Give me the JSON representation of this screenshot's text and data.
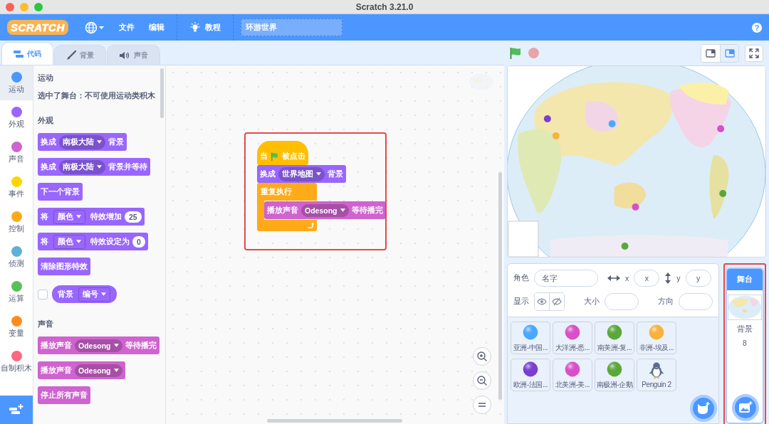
{
  "window": {
    "title": "Scratch 3.21.0"
  },
  "menu": {
    "logo": "SCRATCH",
    "items": [
      {
        "kind": "language"
      },
      {
        "kind": "text",
        "label": "文件"
      },
      {
        "kind": "text",
        "label": "编辑"
      },
      {
        "kind": "tutorial",
        "label": "教程"
      }
    ],
    "project_title": "环游世界",
    "help": "?"
  },
  "tabs": [
    {
      "kind": "code",
      "label": "代码",
      "selected": true
    },
    {
      "kind": "brush",
      "label": "背景",
      "selected": false
    },
    {
      "kind": "sound",
      "label": "声音",
      "selected": false
    }
  ],
  "categories": [
    {
      "label": "运动",
      "color": "#4c97ff",
      "selected": true
    },
    {
      "label": "外观",
      "color": "#9966ff",
      "selected": false
    },
    {
      "label": "声音",
      "color": "#cf63cf",
      "selected": false
    },
    {
      "label": "事件",
      "color": "#ffd500",
      "selected": false
    },
    {
      "label": "控制",
      "color": "#ffab19",
      "selected": false
    },
    {
      "label": "侦测",
      "color": "#5cb1d6",
      "selected": false
    },
    {
      "label": "运算",
      "color": "#59c059",
      "selected": false
    },
    {
      "label": "变量",
      "color": "#ff8c1a",
      "selected": false
    },
    {
      "label": "自制积木",
      "color": "#ff6680",
      "selected": false
    }
  ],
  "palette": [
    {
      "kind": "heading",
      "text": "运动"
    },
    {
      "kind": "note",
      "text": "选中了舞台：不可使用运动类积木"
    },
    {
      "kind": "heading",
      "text": "外观"
    },
    {
      "kind": "block",
      "color": "#9966ff",
      "parts": [
        {
          "kind": "text",
          "text": "换成"
        },
        {
          "kind": "dropdown",
          "text": "南极大陆"
        },
        {
          "kind": "text",
          "text": "背景"
        }
      ]
    },
    {
      "kind": "block",
      "color": "#9966ff",
      "parts": [
        {
          "kind": "text",
          "text": "换成"
        },
        {
          "kind": "dropdown",
          "text": "南极大陆"
        },
        {
          "kind": "text",
          "text": "背景并等待"
        }
      ]
    },
    {
      "kind": "block",
      "color": "#9966ff",
      "parts": [
        {
          "kind": "text",
          "text": "下一个背景"
        }
      ]
    },
    {
      "kind": "block",
      "color": "#9966ff",
      "parts": [
        {
          "kind": "text",
          "text": "将"
        },
        {
          "kind": "menu",
          "text": "颜色"
        },
        {
          "kind": "text",
          "text": "特效增加"
        },
        {
          "kind": "number",
          "text": "25"
        }
      ]
    },
    {
      "kind": "block",
      "color": "#9966ff",
      "parts": [
        {
          "kind": "text",
          "text": "将"
        },
        {
          "kind": "menu",
          "text": "颜色"
        },
        {
          "kind": "text",
          "text": "特效设定为"
        },
        {
          "kind": "number",
          "text": "0"
        }
      ]
    },
    {
      "kind": "block",
      "color": "#9966ff",
      "parts": [
        {
          "kind": "text",
          "text": "清除图形特效"
        }
      ]
    },
    {
      "kind": "reporter",
      "color": "#9966ff",
      "checked": false,
      "parts": [
        {
          "kind": "text",
          "text": "背景"
        },
        {
          "kind": "menu",
          "text": "编号"
        }
      ]
    },
    {
      "kind": "heading",
      "text": "声音"
    },
    {
      "kind": "block",
      "color": "#cf63cf",
      "parts": [
        {
          "kind": "text",
          "text": "播放声音"
        },
        {
          "kind": "dropdown",
          "text": "Odesong"
        },
        {
          "kind": "text",
          "text": "等待播完"
        }
      ]
    },
    {
      "kind": "block",
      "color": "#cf63cf",
      "parts": [
        {
          "kind": "text",
          "text": "播放声音"
        },
        {
          "kind": "dropdown",
          "text": "Odesong"
        }
      ]
    },
    {
      "kind": "block",
      "color": "#cf63cf",
      "parts": [
        {
          "kind": "text",
          "text": "停止所有声音"
        }
      ]
    }
  ],
  "script": [
    {
      "kind": "hat",
      "color": "#ffbf00",
      "parts": [
        {
          "kind": "text",
          "text": "当"
        },
        {
          "kind": "flag"
        },
        {
          "kind": "text",
          "text": "被点击"
        }
      ]
    },
    {
      "kind": "stack",
      "color": "#9966ff",
      "parts": [
        {
          "kind": "text",
          "text": "换成"
        },
        {
          "kind": "dropdown",
          "text": "世界地图"
        },
        {
          "kind": "text",
          "text": "背景"
        }
      ]
    },
    {
      "kind": "c",
      "color": "#ffab19",
      "parts": [
        {
          "kind": "text",
          "text": "重复执行"
        }
      ],
      "children": [
        {
          "kind": "stack",
          "color": "#cf63cf",
          "parts": [
            {
              "kind": "text",
              "text": "播放声音"
            },
            {
              "kind": "dropdown",
              "text": "Odesong"
            },
            {
              "kind": "text",
              "text": "等待播完"
            }
          ]
        }
      ]
    }
  ],
  "sprite_info": {
    "sprite_label": "角色",
    "name_placeholder": "名字",
    "x_label": "x",
    "x_placeholder": "x",
    "y_label": "y",
    "y_placeholder": "y",
    "show_label": "显示",
    "size_label": "大小",
    "direction_label": "方向"
  },
  "sprites": [
    {
      "kind": "ball",
      "name": "亚洲-中国...",
      "color": "#4aa8ff"
    },
    {
      "kind": "ball",
      "name": "大洋洲-悉...",
      "color": "#d94fc8"
    },
    {
      "kind": "ball",
      "name": "南美洲-复...",
      "color": "#5aa83a"
    },
    {
      "kind": "ball",
      "name": "非洲-埃及...",
      "color": "#f7b23c"
    },
    {
      "kind": "ball",
      "name": "欧洲-法国...",
      "color": "#7a3fd0"
    },
    {
      "kind": "ball",
      "name": "北美洲-美...",
      "color": "#d94fc8"
    },
    {
      "kind": "ball",
      "name": "南极洲-企鹅",
      "color": "#5aa83a"
    },
    {
      "kind": "penguin",
      "name": "Penguin 2",
      "color": "#ffffff"
    }
  ],
  "stage_panel": {
    "title": "舞台",
    "selected": true,
    "backdrops_label": "背景",
    "backdrop_count": "8"
  }
}
